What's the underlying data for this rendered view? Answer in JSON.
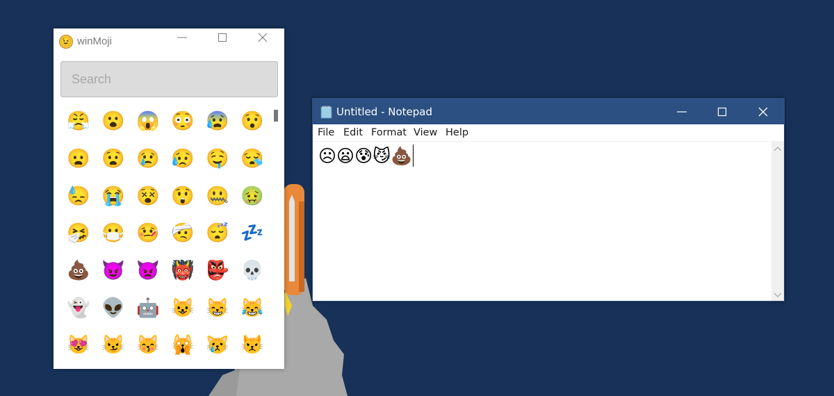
{
  "colors": {
    "desktop_bg": "#173158",
    "notepad_titlebar": "#2b5081",
    "search_bg": "#dcdcdc",
    "rocket_body": "#e8893b",
    "smoke": "#a9a9a9",
    "flame": "#f5d328"
  },
  "winmoji": {
    "app_icon": "😉",
    "title": "winMoji",
    "controls": [
      "minimize-icon",
      "maximize-icon",
      "close-icon"
    ],
    "search": {
      "placeholder": "Search",
      "value": ""
    },
    "emojis": [
      [
        "😤",
        "😮",
        "😱",
        "😳",
        "😰",
        "😯"
      ],
      [
        "😦",
        "😧",
        "😢",
        "😥",
        "🤤",
        "😪"
      ],
      [
        "😓",
        "😭",
        "😵",
        "😲",
        "🤐",
        "🤢"
      ],
      [
        "🤧",
        "😷",
        "🤒",
        "🤕",
        "😴",
        "💤"
      ],
      [
        "💩",
        "😈",
        "👿",
        "👹",
        "👺",
        "💀"
      ],
      [
        "👻",
        "👽",
        "🤖",
        "😺",
        "😸",
        "😹"
      ],
      [
        "😻",
        "😼",
        "😽",
        "🙀",
        "😿",
        "😾"
      ]
    ]
  },
  "notepad": {
    "title": "Untitled - Notepad",
    "menu": [
      "File",
      "Edit",
      "Format",
      "View",
      "Help"
    ],
    "content": "☹😦😰😼💩"
  }
}
